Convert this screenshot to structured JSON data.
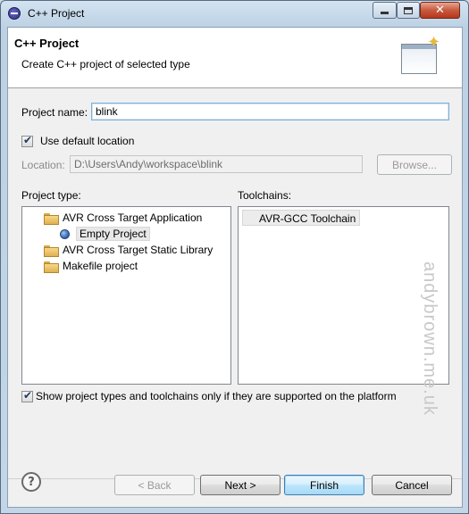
{
  "window": {
    "title": "C++ Project"
  },
  "header": {
    "title": "C++ Project",
    "description": "Create C++ project of selected type"
  },
  "project_name": {
    "label": "Project name:",
    "value": "blink"
  },
  "location": {
    "use_default_label": "Use default location",
    "use_default_checked": true,
    "label": "Location:",
    "value": "D:\\Users\\Andy\\workspace\\blink",
    "browse_label": "Browse..."
  },
  "project_type": {
    "label": "Project type:",
    "items": [
      {
        "label": "AVR Cross Target Application",
        "icon": "folder-icon",
        "level": 0
      },
      {
        "label": "Empty Project",
        "icon": "ball-icon",
        "level": 1,
        "selected": true
      },
      {
        "label": "AVR Cross Target Static Library",
        "icon": "folder-icon",
        "level": 0
      },
      {
        "label": "Makefile project",
        "icon": "folder-icon",
        "level": 0
      }
    ]
  },
  "toolchains": {
    "label": "Toolchains:",
    "items": [
      {
        "label": "AVR-GCC Toolchain"
      }
    ]
  },
  "watermark": "andybrown.me.uk",
  "filter": {
    "label": "Show project types and toolchains only if they are supported on the platform",
    "checked": true
  },
  "buttons": {
    "back": "< Back",
    "next": "Next >",
    "finish": "Finish",
    "cancel": "Cancel"
  },
  "colors": {
    "window_frame": "#c9dbea",
    "default_button": "#3c7fb1",
    "folder": "#e0b04f"
  }
}
